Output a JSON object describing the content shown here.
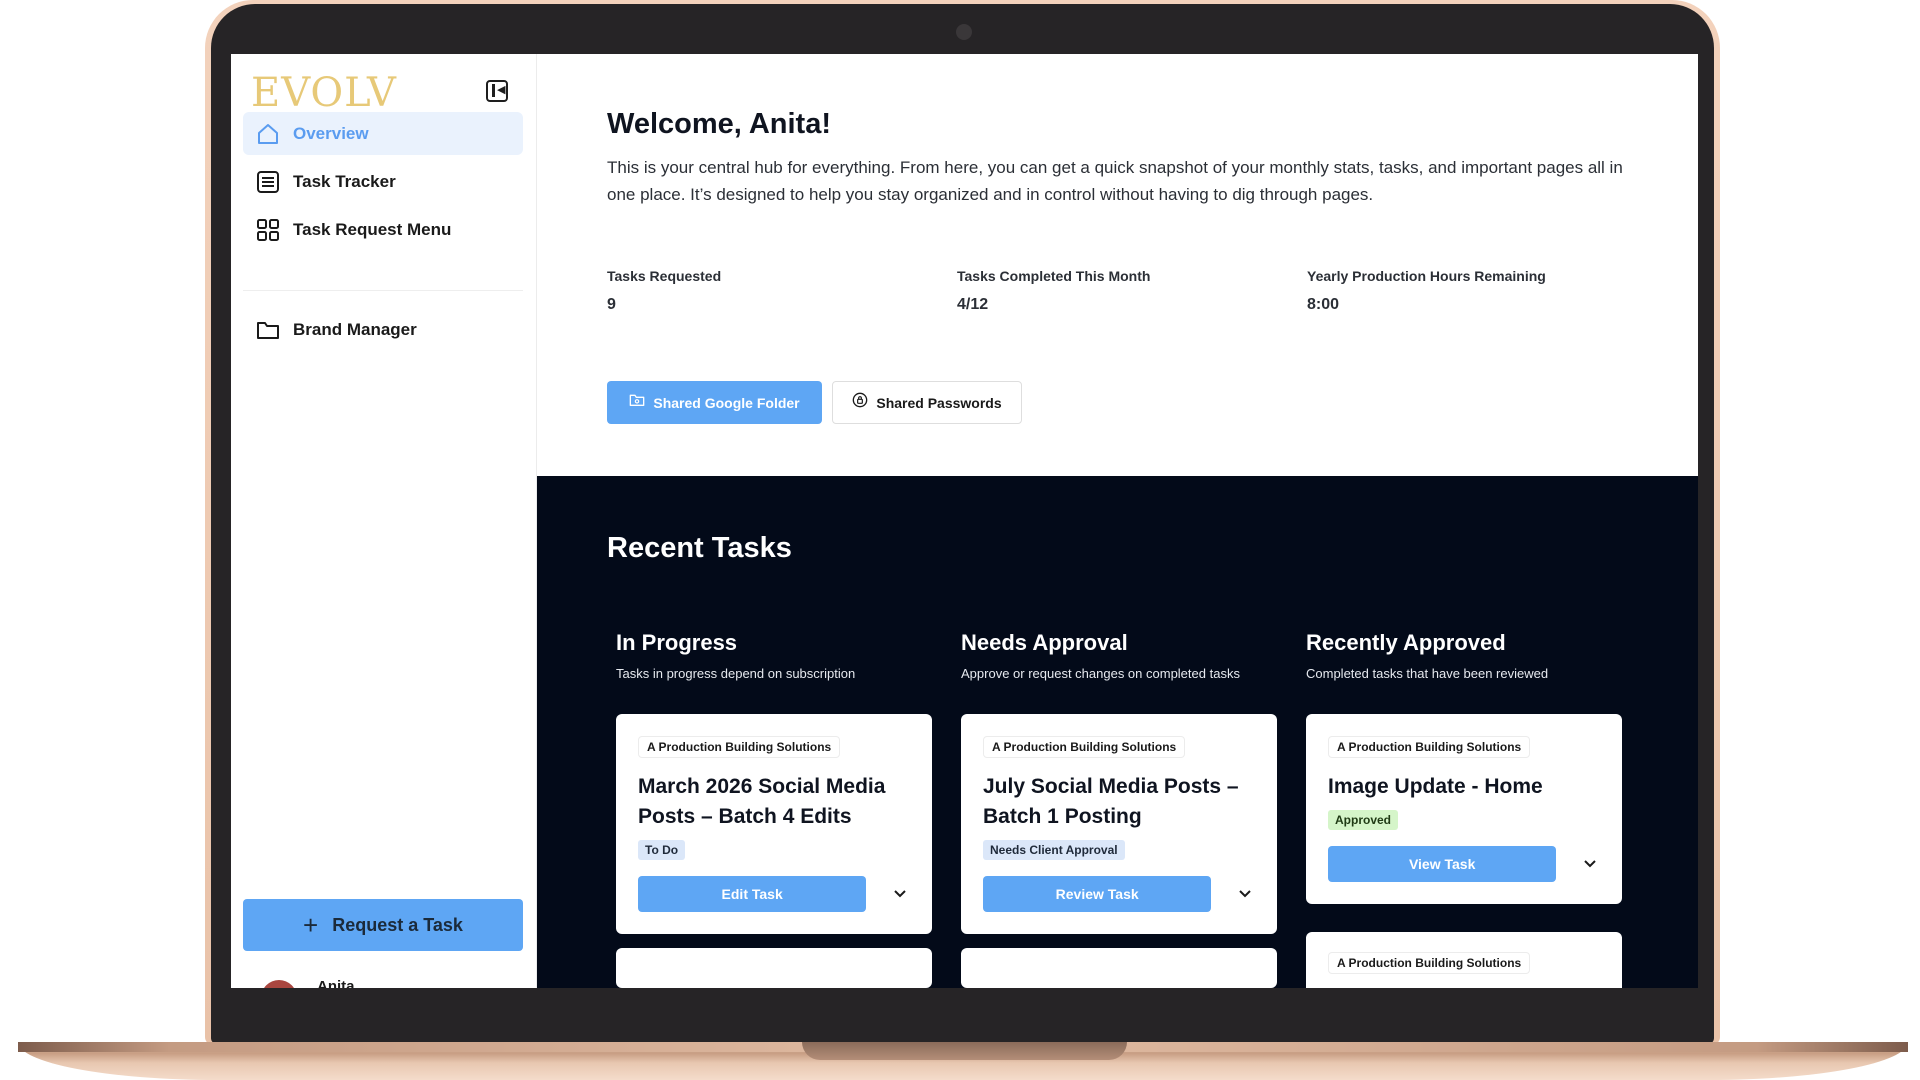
{
  "app": {
    "logo": "EVOLV"
  },
  "sidebar": {
    "items": [
      {
        "label": "Overview",
        "icon": "home-icon",
        "active": true
      },
      {
        "label": "Task Tracker",
        "icon": "list-icon"
      },
      {
        "label": "Task Request Menu",
        "icon": "grid-icon"
      },
      {
        "label": "Brand Manager",
        "icon": "folder-icon"
      }
    ],
    "request_button": "Request a Task",
    "user_name": "Anita"
  },
  "header": {
    "welcome": "Welcome, Anita!",
    "intro": "This is your central hub for everything. From here, you can get a quick snapshot of your monthly stats, tasks, and important pages all in one place. It’s designed to help you stay organized and in control without having to dig through pages."
  },
  "stats": [
    {
      "label": "Tasks Requested",
      "value": "9"
    },
    {
      "label": "Tasks Completed This Month",
      "value": "4/12"
    },
    {
      "label": "Yearly Production Hours Remaining",
      "value": "8:00"
    }
  ],
  "quick_links": {
    "folder": "Shared Google Folder",
    "passwords": "Shared Passwords"
  },
  "recent": {
    "title": "Recent Tasks",
    "columns": [
      {
        "title": "In Progress",
        "subtitle": "Tasks in progress depend on subscription",
        "card": {
          "client": "A Production Building Solutions",
          "title": "March 2026 Social Media Posts – Batch 4 Edits",
          "status": "To Do",
          "action": "Edit Task"
        }
      },
      {
        "title": "Needs Approval",
        "subtitle": "Approve or request changes on completed tasks",
        "card": {
          "client": "A Production Building Solutions",
          "title": "July Social Media Posts – Batch 1 Posting",
          "status": "Needs Client Approval",
          "action": "Review Task"
        }
      },
      {
        "title": "Recently Approved",
        "subtitle": "Completed tasks that have been reviewed",
        "card": {
          "client": "A Production Building Solutions",
          "title": "Image Update - Home",
          "status": "Approved",
          "action": "View Task"
        },
        "next_card_client": "A Production Building Solutions"
      }
    ]
  },
  "colors": {
    "accent": "#5ea6f4",
    "dark_section": "#030a19",
    "logo_gold": "#e7c978",
    "laptop_frame": "#e9c2a8"
  }
}
